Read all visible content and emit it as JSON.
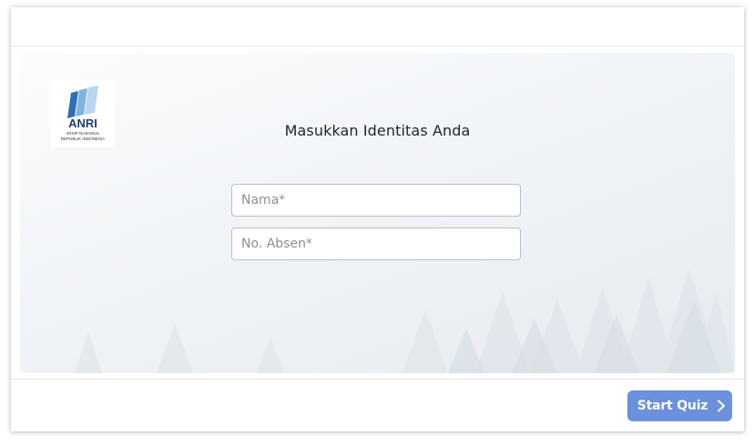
{
  "content": {
    "heading": "Masukkan Identitas Anda",
    "logo": {
      "icon": "anri-logo",
      "text_main": "ANRI",
      "text_line1": "ARSIP NASIONAL",
      "text_line2": "REPUBLIK INDONESIA"
    },
    "form": {
      "name_placeholder": "Nama*",
      "name_value": "",
      "absen_placeholder": "No. Absen*",
      "absen_value": ""
    }
  },
  "footer": {
    "start_label": "Start Quiz",
    "start_icon": "chevron-right-icon",
    "button_color": "#6b90dc"
  }
}
